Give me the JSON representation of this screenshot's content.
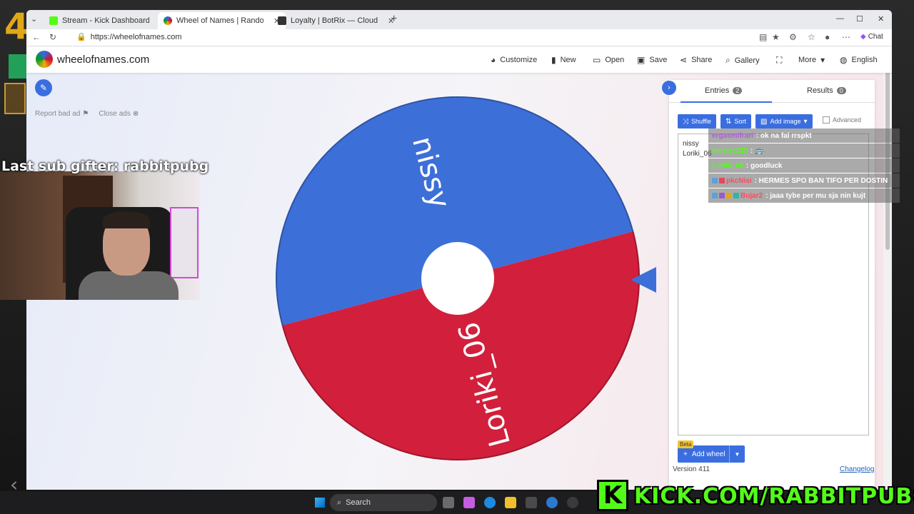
{
  "browser": {
    "tabs": [
      {
        "title": "Stream - Kick Dashboard",
        "active": false,
        "favicon_color": "#53fc18"
      },
      {
        "title": "Wheel of Names | Random name",
        "active": true,
        "favicon_color": "#3369e8"
      },
      {
        "title": "Loyalty | BotRix — Cloud Streamin",
        "active": false,
        "favicon_color": "#333333"
      }
    ],
    "url": "https://wheelofnames.com",
    "chat_label": "Chat"
  },
  "site": {
    "title": "wheelofnames.com",
    "menu": [
      {
        "label": "Customize",
        "icon": "palette-icon"
      },
      {
        "label": "New",
        "icon": "file-icon"
      },
      {
        "label": "Open",
        "icon": "folder-icon"
      },
      {
        "label": "Save",
        "icon": "save-icon"
      },
      {
        "label": "Share",
        "icon": "share-icon"
      },
      {
        "label": "Gallery",
        "icon": "search-icon"
      },
      {
        "label": "",
        "icon": "fullscreen-icon"
      },
      {
        "label": "More",
        "icon": "chevron-down-icon"
      },
      {
        "label": "English",
        "icon": "globe-icon"
      }
    ],
    "report_ad": "Report bad ad",
    "close_ads": "Close ads"
  },
  "wheel": {
    "segments": [
      {
        "label": "nissy",
        "color": "#3d6fd8"
      },
      {
        "label": "Loriki_06",
        "color": "#d21f3c"
      }
    ]
  },
  "panel": {
    "tabs": [
      {
        "label": "Entries",
        "count": "2"
      },
      {
        "label": "Results",
        "count": "0"
      }
    ],
    "buttons": {
      "shuffle": "Shuffle",
      "sort": "Sort",
      "add_image": "Add image",
      "advanced": "Advanced"
    },
    "entries": [
      "nissy",
      "Loriki_06"
    ],
    "beta": "Beta",
    "add_wheel": "Add wheel",
    "version": "Version 411",
    "changelog": "Changelog"
  },
  "chat": [
    {
      "user": "ergasmifrari",
      "user_color": "#b45ddb",
      "message": ": ok na fal rrspkt"
    },
    {
      "user": "moster123",
      "user_color": "#53fc18",
      "message": ": 🚌"
    },
    {
      "user": "Loriki_06",
      "user_color": "#53fc18",
      "message": ": goodluck"
    },
    {
      "user": "pkcNisi",
      "user_color": "#ff4b5c",
      "message": ": HERMES SPO BAN TIFO PER DOSTIN"
    },
    {
      "user": "Bujar2",
      "user_color": "#ff4b5c",
      "message": ": jaaa tybe per mu sja nin kujt"
    }
  ],
  "stream": {
    "sub_gifter": "Last sub gifter: rabbitpubg",
    "kick_url": "KICK.COM/RABBITPUBG",
    "corner_number": "4"
  },
  "taskbar": {
    "search": "Search"
  }
}
